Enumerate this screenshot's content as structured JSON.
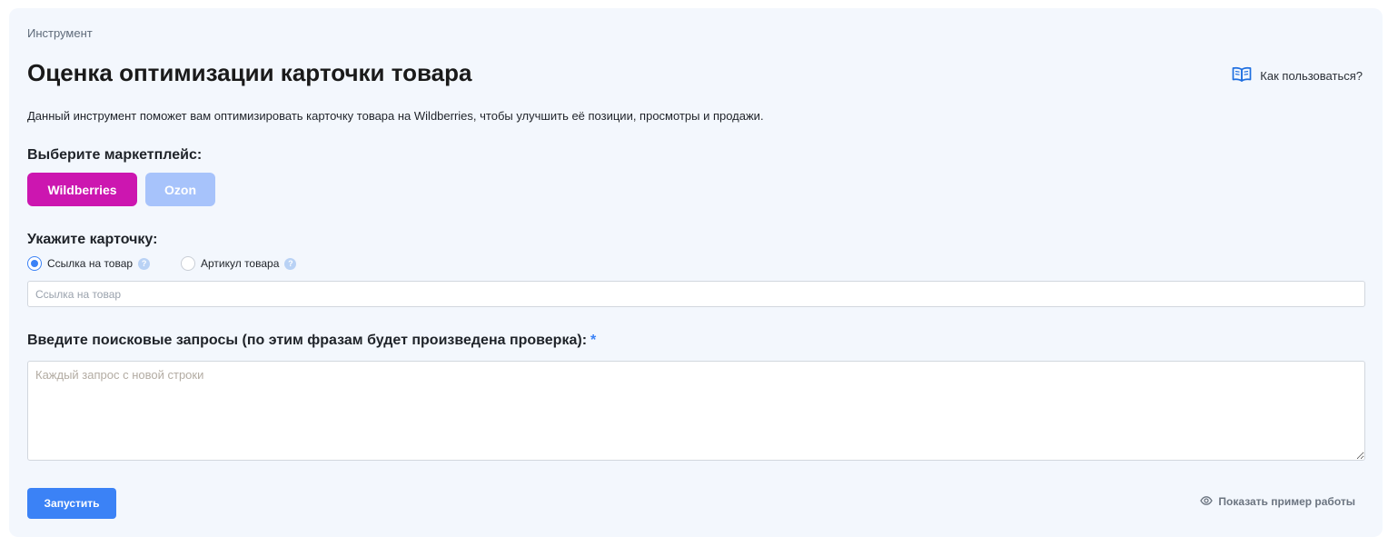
{
  "breadcrumb": "Инструмент",
  "page_title": "Оценка оптимизации карточки товара",
  "help_link": {
    "label": "Как пользоваться?",
    "icon": "book-icon"
  },
  "description": "Данный инструмент поможет вам оптимизировать карточку товара на Wildberries, чтобы улучшить её позиции, просмотры и продажи.",
  "marketplace": {
    "heading": "Выберите маркетплейс:",
    "options": [
      {
        "label": "Wildberries",
        "selected": true,
        "color": "#cc16b0"
      },
      {
        "label": "Ozon",
        "selected": false,
        "color": "#a7c3fb"
      }
    ]
  },
  "card": {
    "heading": "Укажите карточку:",
    "modes": [
      {
        "label": "Ссылка на товар",
        "selected": true
      },
      {
        "label": "Артикул товара",
        "selected": false
      }
    ],
    "input_placeholder": "Ссылка на товар",
    "input_value": ""
  },
  "queries": {
    "heading": "Введите поисковые запросы (по этим фразам будет произведена проверка):",
    "required_mark": "*",
    "placeholder": "Каждый запрос с новой строки",
    "value": ""
  },
  "actions": {
    "run_label": "Запустить",
    "example_label": "Показать пример работы",
    "example_icon": "eye-icon"
  },
  "colors": {
    "accent": "#3b82f6",
    "background": "#f3f7fd"
  }
}
